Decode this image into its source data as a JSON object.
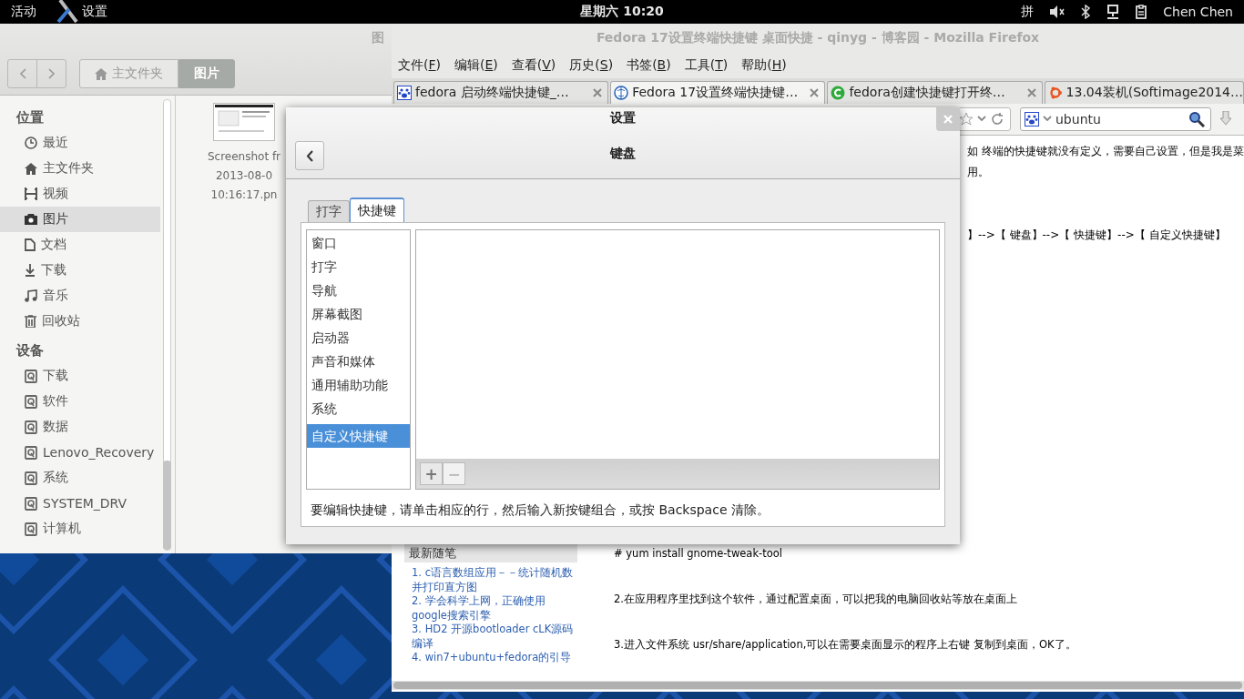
{
  "top_bar": {
    "activities": "活动",
    "app_menu": "设置",
    "clock": "星期六 10:20",
    "input_method": "拼",
    "user": "Chen Chen"
  },
  "files_window": {
    "title": "图",
    "path": [
      {
        "label": "主文件夹",
        "kind": "home",
        "selected": false
      },
      {
        "label": "图片",
        "kind": "plain",
        "selected": true
      }
    ],
    "sidebar": [
      {
        "heading": "位置",
        "items": [
          {
            "label": "最近",
            "kind": "clock",
            "selected": false
          },
          {
            "label": "主文件夹",
            "kind": "home",
            "selected": false
          },
          {
            "label": "视频",
            "kind": "video",
            "selected": false
          },
          {
            "label": "图片",
            "kind": "camera",
            "selected": true
          },
          {
            "label": "文档",
            "kind": "document",
            "selected": false
          },
          {
            "label": "下载",
            "kind": "download",
            "selected": false
          },
          {
            "label": "音乐",
            "kind": "music",
            "selected": false
          },
          {
            "label": "回收站",
            "kind": "trash",
            "selected": false
          }
        ]
      },
      {
        "heading": "设备",
        "items": [
          {
            "label": "下载",
            "kind": "drive",
            "selected": false
          },
          {
            "label": "软件",
            "kind": "drive",
            "selected": false
          },
          {
            "label": "数据",
            "kind": "drive",
            "selected": false
          },
          {
            "label": "Lenovo_Recovery",
            "kind": "drive",
            "selected": false
          },
          {
            "label": "系统",
            "kind": "drive",
            "selected": false
          },
          {
            "label": "SYSTEM_DRV",
            "kind": "drive",
            "selected": false
          },
          {
            "label": "计算机",
            "kind": "drive",
            "selected": false
          }
        ]
      }
    ],
    "file": {
      "name_lines": [
        "Screenshot fr",
        "2013-08-0",
        "10:16:17.pn"
      ]
    }
  },
  "firefox": {
    "title": "Fedora 17设置终端快捷键 桌面快捷 - qinyg - 博客园 - Mozilla Firefox",
    "menu": [
      "文件(F)",
      "编辑(E)",
      "查看(V)",
      "历史(S)",
      "书签(B)",
      "工具(T)",
      "帮助(H)"
    ],
    "tabs": [
      {
        "label": "fedora 启动终端快捷键_…",
        "kind": "paw",
        "selected": false
      },
      {
        "label": "Fedora 17设置终端快捷键…",
        "kind": "globe",
        "selected": true
      },
      {
        "label": "fedora创建快捷键打开终…",
        "kind": "c",
        "selected": false
      },
      {
        "label": "13.04装机(Softimage2014…",
        "kind": "ring",
        "selected": false
      }
    ],
    "search": {
      "value": "ubuntu"
    },
    "article_top": [
      "如 终端的快捷键就没有定义，需要自己设置，但是我是菜",
      "用。",
      "】-->【 键盘】-->【 快捷键】-->【 自定义快捷键】"
    ],
    "sidebar": {
      "heading": "最新随笔",
      "links": [
        "1. c语言数组应用－－统计随机数并打印直方图",
        "2. 学会科学上网，正确使用google搜索引擎",
        "3. HD2 开源bootloader cLK源码编译",
        "4. win7+ubuntu+fedora的引导"
      ]
    },
    "article": [
      "# yum install gnome-tweak-tool",
      "2.在应用程序里找到这个软件，通过配置桌面，可以把我的电脑回收站等放在桌面上",
      "3.进入文件系统 usr/share/application,可以在需要桌面显示的程序上右键 复制到桌面，OK了。"
    ]
  },
  "settings_dialog": {
    "title": "设置",
    "page": "键盘",
    "tabs": [
      {
        "label": "打字",
        "selected": false
      },
      {
        "label": "快捷键",
        "selected": true
      }
    ],
    "categories": [
      {
        "label": "窗口",
        "selected": false
      },
      {
        "label": "打字",
        "selected": false
      },
      {
        "label": "导航",
        "selected": false
      },
      {
        "label": "屏幕截图",
        "selected": false
      },
      {
        "label": "启动器",
        "selected": false
      },
      {
        "label": "声音和媒体",
        "selected": false
      },
      {
        "label": "通用辅助功能",
        "selected": false
      },
      {
        "label": "系统",
        "selected": false
      },
      {
        "label": "自定义快捷键",
        "selected": true
      }
    ],
    "add_button": "+",
    "remove_button": "−",
    "hint": "要编辑快捷键，请单击相应的行，然后输入新按键组合，或按 Backspace 清除。"
  }
}
